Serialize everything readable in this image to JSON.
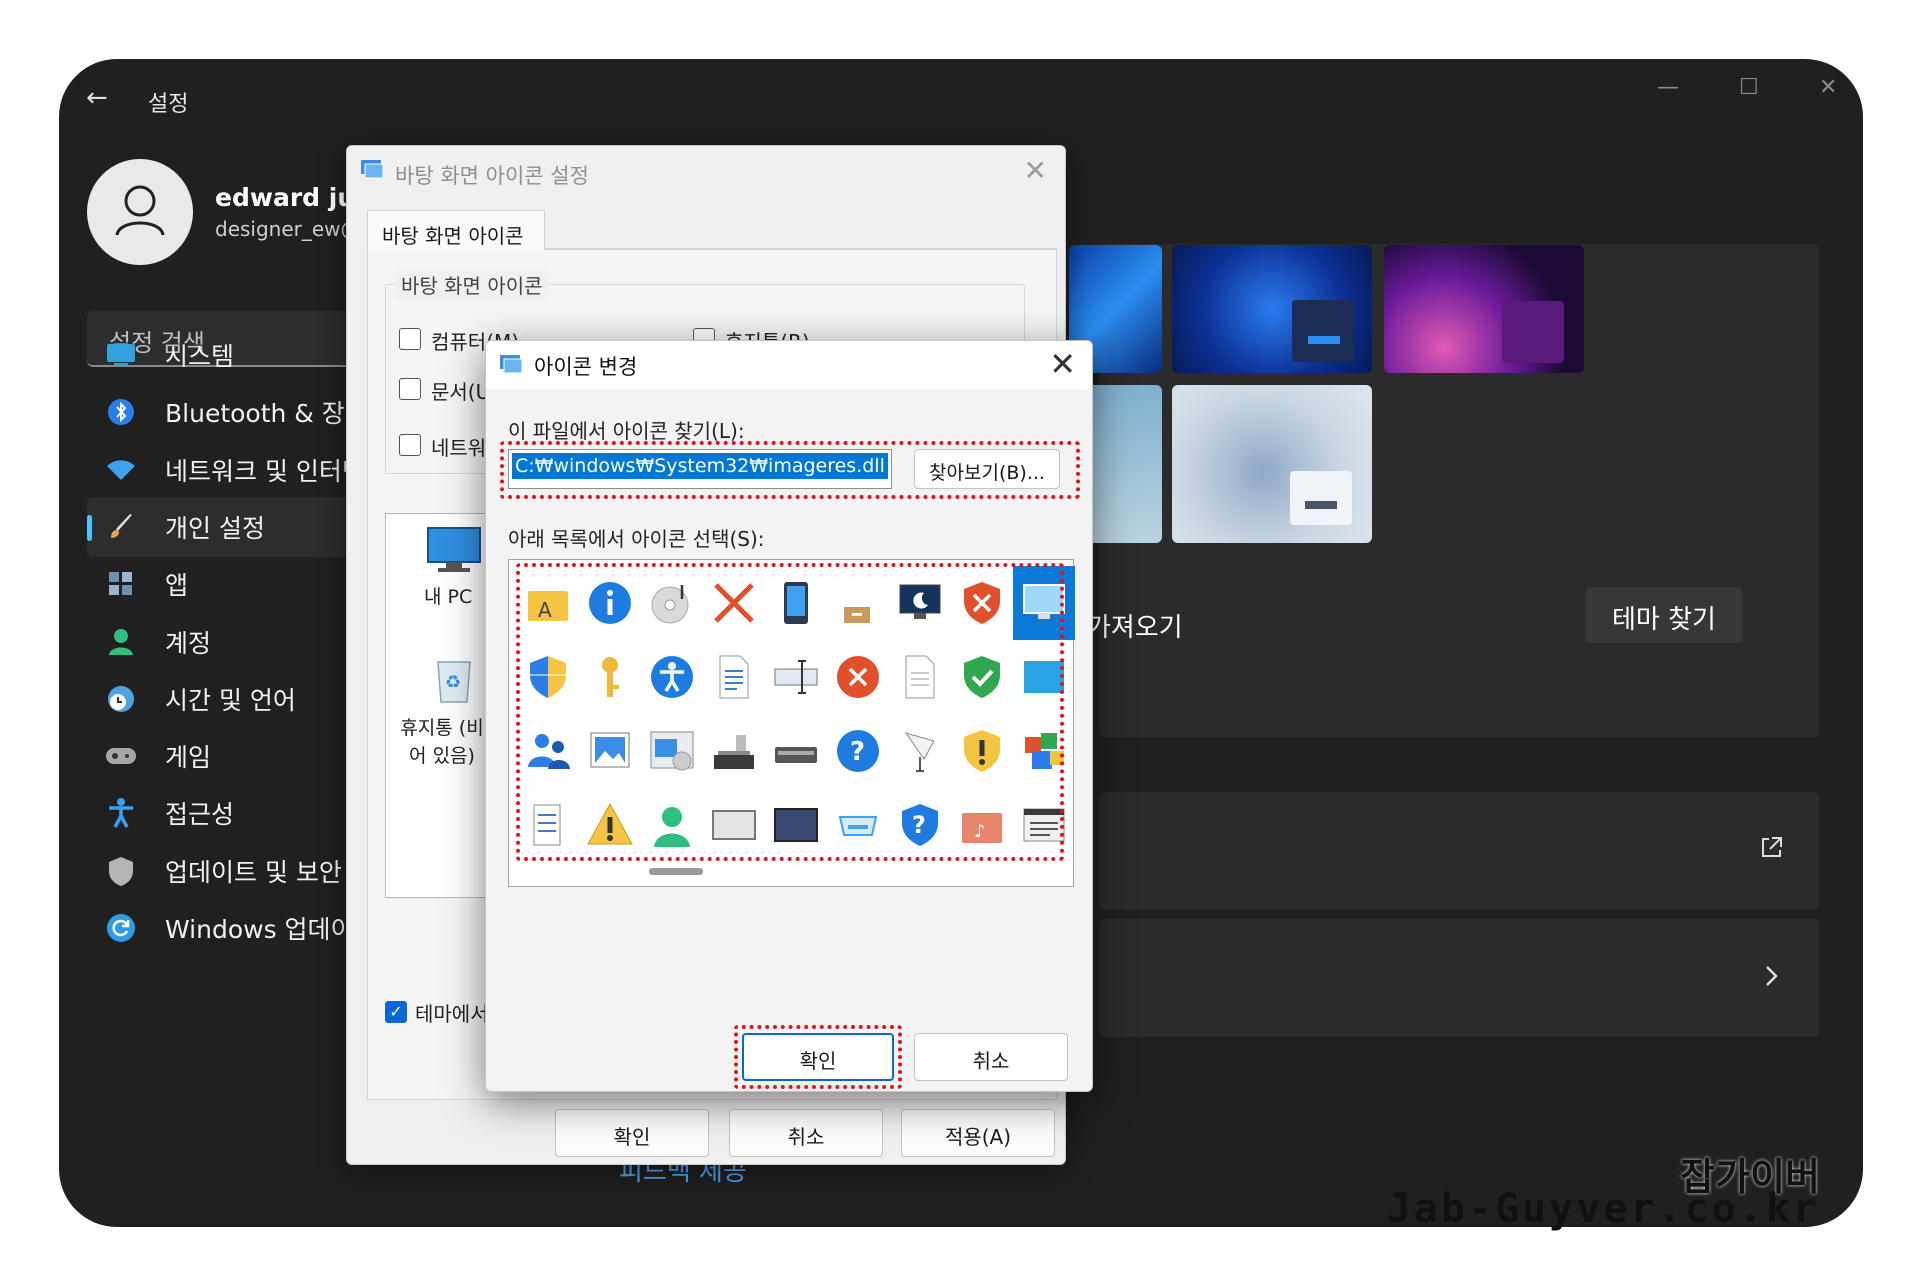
{
  "settings": {
    "back_label": "←",
    "title": "설정",
    "window_controls": [
      "—",
      "☐",
      "✕"
    ],
    "user": {
      "name": "edward jung",
      "email": "designer_ew@"
    },
    "search_placeholder": "설정 검색",
    "nav": [
      {
        "label": "시스템",
        "icon": "monitor-icon",
        "color": "#2fa3e0"
      },
      {
        "label": "Bluetooth & 장치",
        "icon": "bluetooth-icon",
        "color": "#2b7de9"
      },
      {
        "label": "네트워크 및 인터넷",
        "icon": "wifi-icon",
        "color": "#3ea2f0"
      },
      {
        "label": "개인 설정",
        "icon": "brush-icon",
        "color": "#e8a15a",
        "active": true
      },
      {
        "label": "앱",
        "icon": "apps-icon",
        "color": "#6d8fb3"
      },
      {
        "label": "계정",
        "icon": "account-icon",
        "color": "#2fbf7f"
      },
      {
        "label": "시간 및 언어",
        "icon": "clock-globe-icon",
        "color": "#4da3e0"
      },
      {
        "label": "게임",
        "icon": "gamepad-icon",
        "color": "#a7a7a7"
      },
      {
        "label": "접근성",
        "icon": "accessibility-icon",
        "color": "#3a9ff0"
      },
      {
        "label": "업데이트 및 보안",
        "icon": "shield-icon",
        "color": "#b5b5b5"
      },
      {
        "label": "Windows 업데이트",
        "icon": "refresh-icon",
        "color": "#2f9ae8"
      }
    ],
    "theme_import_label": "가져오기",
    "theme_find_button": "테마 찾기",
    "bottom_link": "피드백 제공"
  },
  "desktop_icon_dialog": {
    "title": "바탕 화면 아이콘 설정",
    "tab": "바탕 화면 아이콘",
    "group_label": "바탕 화면 아이콘",
    "checkboxes": [
      {
        "label": "컴퓨터(M)",
        "checked": false
      },
      {
        "label": "휴지통(R)",
        "checked": false
      },
      {
        "label": "문서(U)",
        "checked": false
      },
      {
        "label": "네트워크",
        "checked": false
      }
    ],
    "icons": [
      {
        "label": "내 PC"
      },
      {
        "label": "휴지통 (비어 있음)"
      }
    ],
    "theme_checkbox": {
      "label": "테마에서",
      "checked": true
    },
    "buttons": {
      "ok": "확인",
      "cancel": "취소",
      "apply": "적용(A)"
    }
  },
  "change_icon_dialog": {
    "title": "아이콘 변경",
    "find_label": "이 파일에서 아이콘 찾기(L):",
    "path_value": "C:₩windows₩System32₩imageres.dll",
    "browse_button": "찾아보기(B)...",
    "list_label": "아래 목록에서 아이콘 선택(S):",
    "ok": "확인",
    "cancel": "취소",
    "selected_icon_index": 8,
    "icons": [
      "font-folder-icon",
      "info-icon",
      "cd-music-icon",
      "red-x-icon",
      "phone-device-icon",
      "box-drive-icon",
      "monitor-moon-icon",
      "shield-x-icon",
      "monitor-icon",
      "uac-shield-icon",
      "key-icon",
      "accessibility-icon",
      "document-text-icon",
      "textbox-icon",
      "error-circle-icon",
      "blank-document-icon",
      "green-shield-check-icon",
      "blue-square-icon",
      "users-icon",
      "picture-icon",
      "media-window-icon",
      "scanner-icon",
      "flat-scanner-icon",
      "help-circle-icon",
      "presentation-icon",
      "yellow-shield-warning-icon",
      "blocks-icon",
      "list-icon",
      "warning-icon",
      "user-icon",
      "frame-icon",
      "frame-dark-icon",
      "drive-icon",
      "help-shield-icon",
      "music-folder-icon",
      "window-list-icon"
    ]
  },
  "watermark": {
    "korean": "잡가이버",
    "english": "Jab-Guyver.co.kr"
  }
}
